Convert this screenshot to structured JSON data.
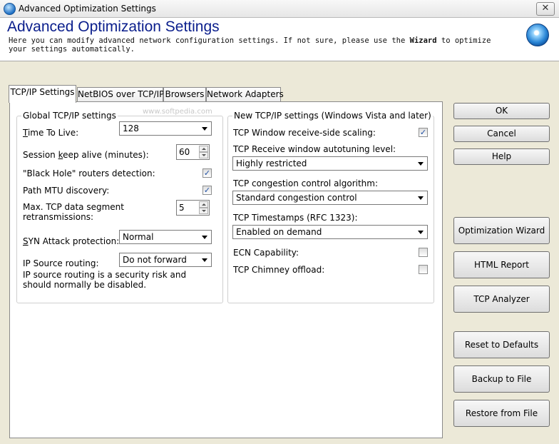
{
  "window": {
    "title": "Advanced Optimization Settings",
    "close_label": "✕"
  },
  "header": {
    "title": "Advanced Optimization Settings",
    "desc_before": "Here you can modify advanced network configuration settings. If not sure, please use the ",
    "desc_bold": "Wizard",
    "desc_after": " to optimize your settings automatically."
  },
  "tabs": [
    {
      "label": "TCP/IP Settings"
    },
    {
      "label": "NetBIOS over TCP/IP"
    },
    {
      "label": "Browsers"
    },
    {
      "label": "Network Adapters"
    }
  ],
  "watermark": "www.softpedia.com",
  "global": {
    "legend": "Global TCP/IP settings",
    "ttl_label_u": "T",
    "ttl_label_rest": "ime To Live:",
    "ttl_value": "128",
    "keepalive_label_a": "Session ",
    "keepalive_label_u": "k",
    "keepalive_label_b": "eep alive (minutes):",
    "keepalive_value": "60",
    "blackhole_label": "\"Black Hole\" routers detection:",
    "blackhole_checked": "✓",
    "pmtu_label": "Path MTU discovery:",
    "pmtu_checked": "✓",
    "maxseg_label": "Max. TCP data segment retransmissions:",
    "maxseg_value": "5",
    "syn_label_u": "S",
    "syn_label_rest": "YN Attack protection:",
    "syn_value": "Normal",
    "iprouting_label": "IP Source routing:",
    "iprouting_value": "Do not forward",
    "iprouting_note": "IP source routing is a security risk and should normally be disabled."
  },
  "vista": {
    "legend": "New TCP/IP settings (Windows Vista and later)",
    "rss_label": "TCP Window receive-side scaling:",
    "rss_checked": "✓",
    "autotune_label": "TCP Receive window autotuning level:",
    "autotune_value": "Highly restricted",
    "congestion_label": "TCP congestion control algorithm:",
    "congestion_value": "Standard congestion control",
    "timestamps_label": "TCP Timestamps (RFC 1323):",
    "timestamps_value": "Enabled on demand",
    "ecn_label": "ECN Capability:",
    "chimney_label": "TCP Chimney offload:"
  },
  "buttons": {
    "ok": "OK",
    "cancel": "Cancel",
    "help": "Help",
    "wizard": "Optimization Wizard",
    "html_report": "HTML Report",
    "tcp_analyzer": "TCP Analyzer",
    "reset": "Reset to Defaults",
    "backup": "Backup to File",
    "restore": "Restore from File"
  }
}
